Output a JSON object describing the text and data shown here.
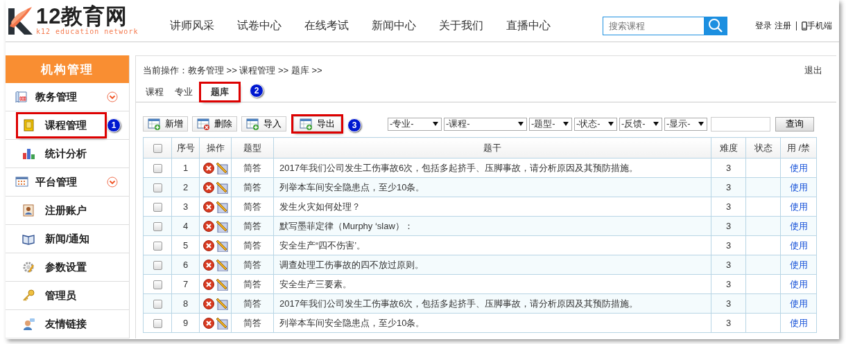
{
  "header": {
    "logo": {
      "title": "12教育网",
      "tagline": "k12 education network"
    },
    "nav": [
      {
        "label": "讲师风采"
      },
      {
        "label": "试卷中心"
      },
      {
        "label": "在线考试"
      },
      {
        "label": "新闻中心"
      },
      {
        "label": "关于我们"
      },
      {
        "label": "直播中心"
      }
    ],
    "search": {
      "placeholder": "搜索课程"
    },
    "links": [
      {
        "label": "登录"
      },
      {
        "label": "注册"
      }
    ],
    "mobile": {
      "label": "手机端"
    }
  },
  "sidebar": {
    "title": "机构管理",
    "groups": [
      {
        "label": "教务管理",
        "expanded": true,
        "children": [
          {
            "label": "课程管理",
            "highlighted": true,
            "callout": "1"
          },
          {
            "label": "统计分析",
            "highlighted": false
          }
        ]
      },
      {
        "label": "平台管理",
        "expanded": true,
        "children": [
          {
            "label": "注册账户",
            "highlighted": false
          },
          {
            "label": "新闻/通知",
            "highlighted": false
          },
          {
            "label": "参数设置",
            "highlighted": false
          },
          {
            "label": "管理员",
            "highlighted": false
          },
          {
            "label": "友情链接",
            "highlighted": false
          }
        ]
      }
    ]
  },
  "content": {
    "breadcrumb": "当前操作：教务管理 >> 课程管理 >> 题库 >>",
    "logout": "退出",
    "tabs": [
      {
        "label": "课程",
        "selected": false,
        "highlighted": false
      },
      {
        "label": "专业",
        "selected": false,
        "highlighted": false
      },
      {
        "label": "题库",
        "selected": true,
        "highlighted": true,
        "callout": "2"
      }
    ],
    "toolbar": [
      {
        "label": "新增",
        "kind": "add",
        "highlighted": false
      },
      {
        "label": "删除",
        "kind": "delete",
        "highlighted": false
      },
      {
        "label": "导入",
        "kind": "add",
        "highlighted": false
      },
      {
        "label": "导出",
        "kind": "add",
        "highlighted": true,
        "callout": "3"
      }
    ],
    "filters": [
      {
        "label": "-专业-",
        "wide": false
      },
      {
        "label": "-课程-",
        "wide": true
      },
      {
        "label": "-题型-",
        "wide": false
      },
      {
        "label": "-状态-",
        "wide": false
      },
      {
        "label": "-反馈-",
        "wide": false
      },
      {
        "label": "-显示-",
        "wide": false
      }
    ],
    "query_button": "查询",
    "table": {
      "select_all": {
        "checked": false
      },
      "columns": [
        "序号",
        "操作",
        "题型",
        "题干",
        "难度",
        "状态",
        "用 /禁"
      ],
      "rows": [
        {
          "checked": false,
          "no": "1",
          "type": "简答",
          "stem": "2017年我们公司发生工伤事故6次，包括多起挤手、压脚事故，请分析原因及其预防措施。",
          "difficulty": "3",
          "action": "使用"
        },
        {
          "checked": false,
          "no": "2",
          "type": "简答",
          "stem": "列举本车间安全隐患点，至少10条。",
          "difficulty": "3",
          "action": "使用"
        },
        {
          "checked": false,
          "no": "3",
          "type": "简答",
          "stem": "发生火灾如何处理？",
          "difficulty": "3",
          "action": "使用"
        },
        {
          "checked": false,
          "no": "4",
          "type": "简答",
          "stem": "默写墨菲定律（Murphy ‘slaw）：",
          "difficulty": "3",
          "action": "使用"
        },
        {
          "checked": false,
          "no": "5",
          "type": "简答",
          "stem": "安全生产“四不伤害’。",
          "difficulty": "3",
          "action": "使用"
        },
        {
          "checked": false,
          "no": "6",
          "type": "简答",
          "stem": "调查处理工伤事故的四不放过原则。",
          "difficulty": "3",
          "action": "使用"
        },
        {
          "checked": false,
          "no": "7",
          "type": "简答",
          "stem": "安全生产三要素。",
          "difficulty": "3",
          "action": "使用"
        },
        {
          "checked": false,
          "no": "8",
          "type": "简答",
          "stem": "2017年我们公司发生工伤事故6次，包括多起挤手、压脚事故，请分析原因及其预防措施。",
          "difficulty": "3",
          "action": "使用"
        },
        {
          "checked": false,
          "no": "9",
          "type": "简答",
          "stem": "列举本车间安全隐患点，至少10条。",
          "difficulty": "3",
          "action": "使用"
        }
      ]
    }
  }
}
